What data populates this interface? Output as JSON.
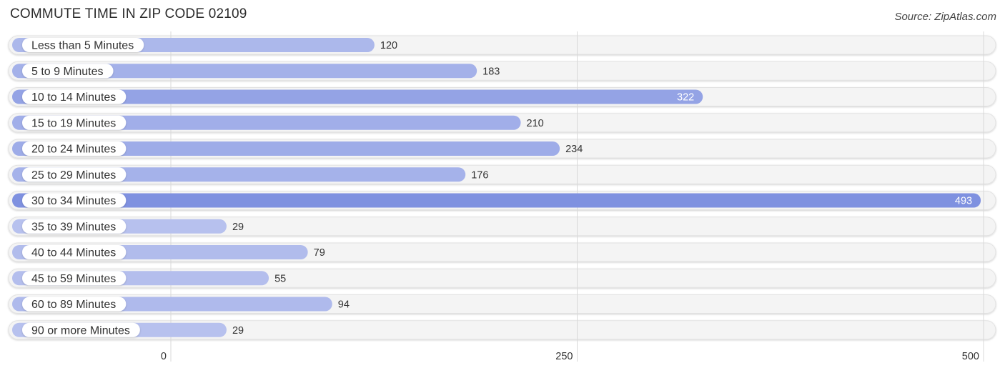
{
  "header": {
    "title": "COMMUTE TIME IN ZIP CODE 02109",
    "source": "Source: ZipAtlas.com"
  },
  "chart_data": {
    "type": "bar",
    "orientation": "horizontal",
    "title": "COMMUTE TIME IN ZIP CODE 02109",
    "categories": [
      "Less than 5 Minutes",
      "5 to 9 Minutes",
      "10 to 14 Minutes",
      "15 to 19 Minutes",
      "20 to 24 Minutes",
      "25 to 29 Minutes",
      "30 to 34 Minutes",
      "35 to 39 Minutes",
      "40 to 44 Minutes",
      "45 to 59 Minutes",
      "60 to 89 Minutes",
      "90 or more Minutes"
    ],
    "values": [
      120,
      183,
      322,
      210,
      234,
      176,
      493,
      29,
      79,
      55,
      94,
      29
    ],
    "xlim": [
      0,
      500
    ],
    "xticks": [
      0,
      250,
      500
    ],
    "xtick_labels": [
      "0",
      "250",
      "500"
    ],
    "xlabel": "",
    "ylabel": "",
    "grid": true,
    "legend": "none",
    "colors": {
      "bar_max": "#7f91e0",
      "bar_min": "#b7c1ee",
      "track": "#f4f4f4",
      "label_pill": "#ffffff"
    }
  }
}
